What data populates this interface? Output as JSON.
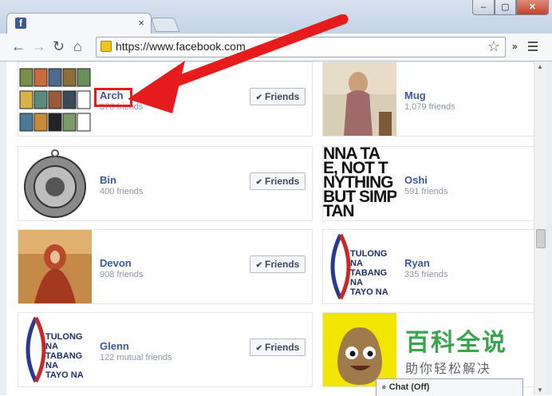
{
  "browser": {
    "url": "https://www.facebook.com",
    "tab_close": "×",
    "ext_label": "»",
    "window": {
      "min": "–",
      "max": "▢",
      "close": "✕"
    }
  },
  "cards": [
    {
      "name": "Arch",
      "sub": "370 friends",
      "button": "Friends"
    },
    {
      "name": "Mug",
      "sub": "1,079 friends"
    },
    {
      "name": "Bin",
      "sub": "400 friends",
      "button": "Friends"
    },
    {
      "name": "Oshi",
      "sub": "591 friends"
    },
    {
      "name": "Devon",
      "sub": "908 friends",
      "button": "Friends"
    },
    {
      "name": "Ryan",
      "sub": "335 friends"
    },
    {
      "name": "Glenn",
      "sub": "122 mutual friends",
      "button": "Friends"
    }
  ],
  "thumb_texts": {
    "oshi_lines": [
      "NNA TA",
      "E, NOT T",
      "NYTHING",
      "BUT SIMP",
      "TAN"
    ],
    "tulong_lines": [
      "TULONG NA",
      "TABANG NA",
      "TAYO NA"
    ]
  },
  "chat": {
    "label": "Chat (Off)"
  },
  "watermark": {
    "main": "百科全说",
    "sub": "助你轻松解决"
  },
  "colors": {
    "fb_blue": "#3b5998",
    "highlight_red": "#e61b1b",
    "watermark_green": "#3aa34d"
  }
}
